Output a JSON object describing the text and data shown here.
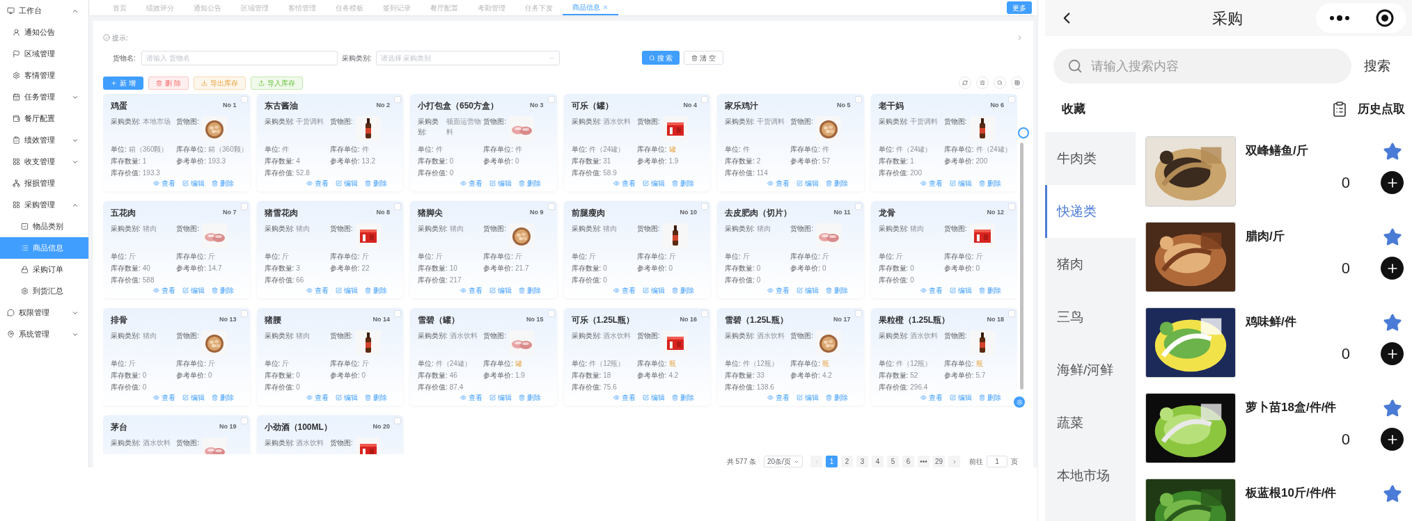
{
  "sidebar": {
    "items": [
      {
        "label": "工作台",
        "kind": "group",
        "expanded": true,
        "selected": false,
        "children": [
          {
            "label": "通知公告",
            "kind": "link",
            "selected": false
          },
          {
            "label": "区域管理",
            "kind": "link",
            "selected": false
          },
          {
            "label": "客情管理",
            "kind": "link",
            "selected": false
          },
          {
            "label": "任务管理",
            "kind": "group",
            "expanded": false,
            "selected": false
          },
          {
            "label": "餐厅配置",
            "kind": "link",
            "selected": false
          },
          {
            "label": "绩效管理",
            "kind": "group",
            "expanded": false,
            "selected": false
          },
          {
            "label": "收支管理",
            "kind": "group",
            "expanded": false,
            "selected": false
          },
          {
            "label": "报损管理",
            "kind": "link",
            "selected": false
          },
          {
            "label": "采购管理",
            "kind": "group",
            "expanded": true,
            "selected": false,
            "children": [
              {
                "label": "物品类别",
                "kind": "link",
                "selected": false
              },
              {
                "label": "商品信息",
                "kind": "link",
                "selected": true
              },
              {
                "label": "采购订单",
                "kind": "link",
                "selected": false
              },
              {
                "label": "到货汇总",
                "kind": "link",
                "selected": false
              }
            ]
          }
        ]
      },
      {
        "label": "权限管理",
        "kind": "group",
        "expanded": false,
        "selected": false
      },
      {
        "label": "系统管理",
        "kind": "group",
        "expanded": false,
        "selected": false
      }
    ]
  },
  "tabs": [
    {
      "label": "首页",
      "selected": false
    },
    {
      "label": "绩效评分",
      "selected": false
    },
    {
      "label": "通知公告",
      "selected": false
    },
    {
      "label": "区域管理",
      "selected": false
    },
    {
      "label": "客情管理",
      "selected": false
    },
    {
      "label": "任务模板",
      "selected": false
    },
    {
      "label": "签到记录",
      "selected": false
    },
    {
      "label": "餐厅配置",
      "selected": false
    },
    {
      "label": "考勤管理",
      "selected": false
    },
    {
      "label": "任务下发",
      "selected": false
    },
    {
      "label": "商品信息",
      "selected": true
    }
  ],
  "more_button": "更多",
  "hint": "提示:",
  "filters": {
    "name_label": "货物名:",
    "name_placeholder": "请输入 货物名",
    "category_label": "采购类别:",
    "category_placeholder": "请选择 采购类别",
    "search_button": "搜 索",
    "clear_button": "清 空"
  },
  "toolbar": [
    {
      "label": "新 增",
      "kind": "primary"
    },
    {
      "label": "删 除",
      "kind": "danger"
    },
    {
      "label": "导出库存",
      "kind": "warning"
    },
    {
      "label": "导入库存",
      "kind": "success"
    }
  ],
  "cards": [
    {
      "title": "鸡蛋",
      "no": "No 1",
      "checked": false,
      "category": {
        "label": "采购类别:",
        "value": "本地市场"
      },
      "image_label": "货物图:",
      "fields": [
        {
          "label": "单位:",
          "value": "箱（360颗）",
          "highlighted": false
        },
        {
          "label": "库存单位:",
          "value": "箱（360颗）",
          "highlighted": false
        },
        {
          "label": "库存数量:",
          "value": "1",
          "highlighted": false
        },
        {
          "label": "参考单价:",
          "value": "193.3",
          "highlighted": false
        },
        {
          "label": "库存价值:",
          "value": "193.3",
          "highlighted": false
        }
      ],
      "actions": [
        "查看",
        "编辑",
        "删除"
      ]
    },
    {
      "title": "东古酱油",
      "no": "No 2",
      "checked": false,
      "category": {
        "label": "采购类别:",
        "value": "干货调料"
      },
      "image_label": "货物图:",
      "fields": [
        {
          "label": "单位:",
          "value": "件",
          "highlighted": false
        },
        {
          "label": "库存单位:",
          "value": "件",
          "highlighted": false
        },
        {
          "label": "库存数量:",
          "value": "4",
          "highlighted": false
        },
        {
          "label": "参考单价:",
          "value": "13.2",
          "highlighted": false
        },
        {
          "label": "库存价值:",
          "value": "52.8",
          "highlighted": false
        }
      ],
      "actions": [
        "查看",
        "编辑",
        "删除"
      ]
    },
    {
      "title": "小打包盒（650方盒）",
      "no": "No 3",
      "checked": false,
      "category": {
        "label": "采购类别:",
        "value": "顿面运营物料"
      },
      "image_label": "货物图:",
      "fields": [
        {
          "label": "单位:",
          "value": "件",
          "highlighted": false
        },
        {
          "label": "库存单位:",
          "value": "件",
          "highlighted": false
        },
        {
          "label": "库存数量:",
          "value": "0",
          "highlighted": false
        },
        {
          "label": "参考单价:",
          "value": "0",
          "highlighted": false
        },
        {
          "label": "库存价值:",
          "value": "0",
          "highlighted": false
        }
      ],
      "actions": [
        "查看",
        "编辑",
        "删除"
      ]
    },
    {
      "title": "可乐（罐）",
      "no": "No 4",
      "checked": false,
      "category": {
        "label": "采购类别:",
        "value": "酒水饮料"
      },
      "image_label": "货物图:",
      "fields": [
        {
          "label": "单位:",
          "value": "件（24罐）",
          "highlighted": false
        },
        {
          "label": "库存单位:",
          "value": "罐",
          "highlighted": true
        },
        {
          "label": "库存数量:",
          "value": "31",
          "highlighted": false
        },
        {
          "label": "参考单价:",
          "value": "1.9",
          "highlighted": false
        },
        {
          "label": "库存价值:",
          "value": "58.9",
          "highlighted": false
        }
      ],
      "actions": [
        "查看",
        "编辑",
        "删除"
      ]
    },
    {
      "title": "家乐鸡汁",
      "no": "No 5",
      "checked": false,
      "category": {
        "label": "采购类别:",
        "value": "干货调料"
      },
      "image_label": "货物图:",
      "fields": [
        {
          "label": "单位:",
          "value": "件",
          "highlighted": false
        },
        {
          "label": "库存单位:",
          "value": "件",
          "highlighted": false
        },
        {
          "label": "库存数量:",
          "value": "2",
          "highlighted": false
        },
        {
          "label": "参考单价:",
          "value": "57",
          "highlighted": false
        },
        {
          "label": "库存价值:",
          "value": "114",
          "highlighted": false
        }
      ],
      "actions": [
        "查看",
        "编辑",
        "删除"
      ]
    },
    {
      "title": "老干妈",
      "no": "No 6",
      "checked": false,
      "category": {
        "label": "采购类别:",
        "value": "干货调料"
      },
      "image_label": "货物图:",
      "fields": [
        {
          "label": "单位:",
          "value": "件（24罐）",
          "highlighted": false
        },
        {
          "label": "库存单位:",
          "value": "件（24罐）",
          "highlighted": false
        },
        {
          "label": "库存数量:",
          "value": "1",
          "highlighted": false
        },
        {
          "label": "参考单价:",
          "value": "200",
          "highlighted": false
        },
        {
          "label": "库存价值:",
          "value": "200",
          "highlighted": false
        }
      ],
      "actions": [
        "查看",
        "编辑",
        "删除"
      ]
    },
    {
      "title": "五花肉",
      "no": "No 7",
      "checked": false,
      "category": {
        "label": "采购类别:",
        "value": "猪肉"
      },
      "image_label": "货物图:",
      "fields": [
        {
          "label": "单位:",
          "value": "斤",
          "highlighted": false
        },
        {
          "label": "库存单位:",
          "value": "斤",
          "highlighted": false
        },
        {
          "label": "库存数量:",
          "value": "40",
          "highlighted": false
        },
        {
          "label": "参考单价:",
          "value": "14.7",
          "highlighted": false
        },
        {
          "label": "库存价值:",
          "value": "588",
          "highlighted": false
        }
      ],
      "actions": [
        "查看",
        "编辑",
        "删除"
      ]
    },
    {
      "title": "猪雪花肉",
      "no": "No 8",
      "checked": false,
      "category": {
        "label": "采购类别:",
        "value": "猪肉"
      },
      "image_label": "货物图:",
      "fields": [
        {
          "label": "单位:",
          "value": "斤",
          "highlighted": false
        },
        {
          "label": "库存单位:",
          "value": "斤",
          "highlighted": false
        },
        {
          "label": "库存数量:",
          "value": "3",
          "highlighted": false
        },
        {
          "label": "参考单价:",
          "value": "22",
          "highlighted": false
        },
        {
          "label": "库存价值:",
          "value": "66",
          "highlighted": false
        }
      ],
      "actions": [
        "查看",
        "编辑",
        "删除"
      ]
    },
    {
      "title": "猪脚尖",
      "no": "No 9",
      "checked": false,
      "category": {
        "label": "采购类别:",
        "value": "猪肉"
      },
      "image_label": "货物图:",
      "fields": [
        {
          "label": "单位:",
          "value": "斤",
          "highlighted": false
        },
        {
          "label": "库存单位:",
          "value": "斤",
          "highlighted": false
        },
        {
          "label": "库存数量:",
          "value": "10",
          "highlighted": false
        },
        {
          "label": "参考单价:",
          "value": "21.7",
          "highlighted": false
        },
        {
          "label": "库存价值:",
          "value": "217",
          "highlighted": false
        }
      ],
      "actions": [
        "查看",
        "编辑",
        "删除"
      ]
    },
    {
      "title": "前腿瘦肉",
      "no": "No 10",
      "checked": false,
      "category": {
        "label": "采购类别:",
        "value": "猪肉"
      },
      "image_label": "货物图:",
      "fields": [
        {
          "label": "单位:",
          "value": "斤",
          "highlighted": false
        },
        {
          "label": "库存单位:",
          "value": "斤",
          "highlighted": false
        },
        {
          "label": "库存数量:",
          "value": "0",
          "highlighted": false
        },
        {
          "label": "参考单价:",
          "value": "0",
          "highlighted": false
        },
        {
          "label": "库存价值:",
          "value": "0",
          "highlighted": false
        }
      ],
      "actions": [
        "查看",
        "编辑",
        "删除"
      ]
    },
    {
      "title": "去皮肥肉（切片）",
      "no": "No 11",
      "checked": false,
      "category": {
        "label": "采购类别:",
        "value": "猪肉"
      },
      "image_label": "货物图:",
      "fields": [
        {
          "label": "单位:",
          "value": "斤",
          "highlighted": false
        },
        {
          "label": "库存单位:",
          "value": "斤",
          "highlighted": false
        },
        {
          "label": "库存数量:",
          "value": "0",
          "highlighted": false
        },
        {
          "label": "参考单价:",
          "value": "0",
          "highlighted": false
        },
        {
          "label": "库存价值:",
          "value": "0",
          "highlighted": false
        }
      ],
      "actions": [
        "查看",
        "编辑",
        "删除"
      ]
    },
    {
      "title": "龙骨",
      "no": "No 12",
      "checked": false,
      "category": {
        "label": "采购类别:",
        "value": "猪肉"
      },
      "image_label": "货物图:",
      "fields": [
        {
          "label": "单位:",
          "value": "斤",
          "highlighted": false
        },
        {
          "label": "库存单位:",
          "value": "斤",
          "highlighted": false
        },
        {
          "label": "库存数量:",
          "value": "0",
          "highlighted": false
        },
        {
          "label": "参考单价:",
          "value": "0",
          "highlighted": false
        },
        {
          "label": "库存价值:",
          "value": "0",
          "highlighted": false
        }
      ],
      "actions": [
        "查看",
        "编辑",
        "删除"
      ]
    },
    {
      "title": "排骨",
      "no": "No 13",
      "checked": false,
      "category": {
        "label": "采购类别:",
        "value": "猪肉"
      },
      "image_label": "货物图:",
      "fields": [
        {
          "label": "单位:",
          "value": "斤",
          "highlighted": false
        },
        {
          "label": "库存单位:",
          "value": "斤",
          "highlighted": false
        },
        {
          "label": "库存数量:",
          "value": "0",
          "highlighted": false
        },
        {
          "label": "参考单价:",
          "value": "0",
          "highlighted": false
        },
        {
          "label": "库存价值:",
          "value": "0",
          "highlighted": false
        }
      ],
      "actions": [
        "查看",
        "编辑",
        "删除"
      ]
    },
    {
      "title": "猪腰",
      "no": "No 14",
      "checked": false,
      "category": {
        "label": "采购类别:",
        "value": "猪肉"
      },
      "image_label": "货物图:",
      "fields": [
        {
          "label": "单位:",
          "value": "斤",
          "highlighted": false
        },
        {
          "label": "库存单位:",
          "value": "斤",
          "highlighted": false
        },
        {
          "label": "库存数量:",
          "value": "0",
          "highlighted": false
        },
        {
          "label": "参考单价:",
          "value": "0",
          "highlighted": false
        },
        {
          "label": "库存价值:",
          "value": "0",
          "highlighted": false
        }
      ],
      "actions": [
        "查看",
        "编辑",
        "删除"
      ]
    },
    {
      "title": "雪碧（罐）",
      "no": "No 15",
      "checked": false,
      "category": {
        "label": "采购类别:",
        "value": "酒水饮料"
      },
      "image_label": "货物图:",
      "fields": [
        {
          "label": "单位:",
          "value": "件（24罐）",
          "highlighted": false
        },
        {
          "label": "库存单位:",
          "value": "罐",
          "highlighted": true
        },
        {
          "label": "库存数量:",
          "value": "46",
          "highlighted": false
        },
        {
          "label": "参考单价:",
          "value": "1.9",
          "highlighted": false
        },
        {
          "label": "库存价值:",
          "value": "87.4",
          "highlighted": false
        }
      ],
      "actions": [
        "查看",
        "编辑",
        "删除"
      ]
    },
    {
      "title": "可乐（1.25L瓶）",
      "no": "No 16",
      "checked": false,
      "category": {
        "label": "采购类别:",
        "value": "酒水饮料"
      },
      "image_label": "货物图:",
      "fields": [
        {
          "label": "单位:",
          "value": "件（12瓶）",
          "highlighted": false
        },
        {
          "label": "库存单位:",
          "value": "瓶",
          "highlighted": true
        },
        {
          "label": "库存数量:",
          "value": "18",
          "highlighted": false
        },
        {
          "label": "参考单价:",
          "value": "4.2",
          "highlighted": false
        },
        {
          "label": "库存价值:",
          "value": "75.6",
          "highlighted": false
        }
      ],
      "actions": [
        "查看",
        "编辑",
        "删除"
      ]
    },
    {
      "title": "雪碧（1.25L瓶）",
      "no": "No 17",
      "checked": false,
      "category": {
        "label": "采购类别:",
        "value": "酒水饮料"
      },
      "image_label": "货物图:",
      "fields": [
        {
          "label": "单位:",
          "value": "件（12瓶）",
          "highlighted": false
        },
        {
          "label": "库存单位:",
          "value": "瓶",
          "highlighted": true
        },
        {
          "label": "库存数量:",
          "value": "33",
          "highlighted": false
        },
        {
          "label": "参考单价:",
          "value": "4.2",
          "highlighted": false
        },
        {
          "label": "库存价值:",
          "value": "138.6",
          "highlighted": false
        }
      ],
      "actions": [
        "查看",
        "编辑",
        "删除"
      ]
    },
    {
      "title": "果粒橙（1.25L瓶）",
      "no": "No 18",
      "checked": false,
      "category": {
        "label": "采购类别:",
        "value": "酒水饮料"
      },
      "image_label": "货物图:",
      "fields": [
        {
          "label": "单位:",
          "value": "件（12瓶）",
          "highlighted": false
        },
        {
          "label": "库存单位:",
          "value": "瓶",
          "highlighted": true
        },
        {
          "label": "库存数量:",
          "value": "52",
          "highlighted": false
        },
        {
          "label": "参考单价:",
          "value": "5.7",
          "highlighted": false
        },
        {
          "label": "库存价值:",
          "value": "296.4",
          "highlighted": false
        }
      ],
      "actions": [
        "查看",
        "编辑",
        "删除"
      ]
    },
    {
      "title": "茅台",
      "no": "No 19",
      "checked": false,
      "category": {
        "label": "采购类别:",
        "value": "酒水饮料"
      },
      "image_label": "货物图:"
    },
    {
      "title": "小劲酒（100ML）",
      "no": "No 20",
      "checked": false,
      "category": {
        "label": "采购类别:",
        "value": "酒水饮料"
      },
      "image_label": "货物图:"
    }
  ],
  "pagination": {
    "total": "共 577 条",
    "page_size": "20条/页",
    "pages": [
      {
        "label": "1",
        "selected": true
      },
      {
        "label": "2",
        "selected": false
      },
      {
        "label": "3",
        "selected": false
      },
      {
        "label": "4",
        "selected": false
      },
      {
        "label": "5",
        "selected": false
      },
      {
        "label": "6",
        "selected": false
      },
      {
        "label": "•••",
        "selected": false
      },
      {
        "label": "29",
        "selected": false
      }
    ],
    "goto_label": "前往",
    "goto_value": "1",
    "goto_suffix": "页"
  },
  "mobile": {
    "title": "采购",
    "search_placeholder": "请输入搜索内容",
    "search_button": "搜索",
    "favorites": "收藏",
    "history": "历史点取",
    "categories": [
      {
        "label": "牛肉类",
        "selected": false
      },
      {
        "label": "快递类",
        "selected": true
      },
      {
        "label": "猪肉",
        "selected": false
      },
      {
        "label": "三鸟",
        "selected": false
      },
      {
        "label": "海鲜/河鲜",
        "selected": false
      },
      {
        "label": "蔬菜",
        "selected": false
      },
      {
        "label": "本地市场",
        "selected": false
      }
    ],
    "products": [
      {
        "name": "双峰鳝鱼/斤",
        "count": "0",
        "favorite": true
      },
      {
        "name": "腊肉/斤",
        "count": "0",
        "favorite": true
      },
      {
        "name": "鸡味鲜/件",
        "count": "0",
        "favorite": true
      },
      {
        "name": "萝卜苗18盒/件/件",
        "count": "0",
        "favorite": true
      },
      {
        "name": "板蓝根10斤/件/件",
        "favorite": true
      }
    ]
  }
}
